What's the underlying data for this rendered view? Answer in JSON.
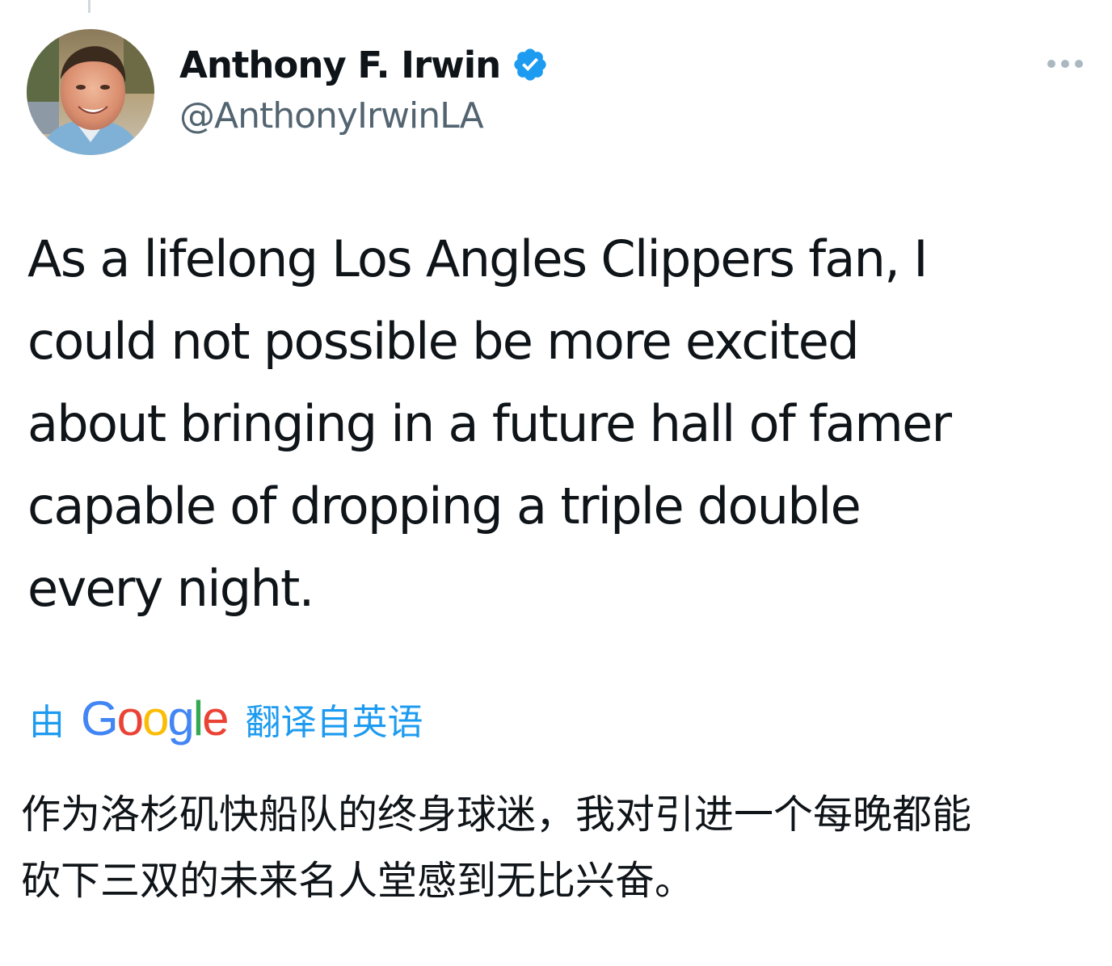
{
  "tweet": {
    "author": {
      "display_name": "Anthony F. Irwin",
      "handle": "@AnthonyIrwinLA",
      "verified": true,
      "verified_icon": "verified-badge-icon",
      "avatar_icon": "profile-photo"
    },
    "more_icon": "more-horizontal-icon",
    "text_lines": [
      "As a lifelong Los Angles Clippers fan, I",
      "could not possible be more excited",
      "about bringing in a future hall of famer",
      "capable of dropping a triple double",
      "every night."
    ],
    "translation": {
      "prefix": "由",
      "provider": "Google",
      "suffix": "翻译自英语",
      "lines": [
        "作为洛杉矶快船队的终身球迷，我对引进一个每晚都能",
        "砍下三双的未来名人堂感到无比兴奋。"
      ]
    }
  },
  "colors": {
    "text_primary": "#0f1419",
    "text_secondary": "#536471",
    "link_blue": "#1d9bf0",
    "verified_blue": "#1d9bf0",
    "google_blue": "#4285f4",
    "google_red": "#ea4335",
    "google_yellow": "#fbbc05",
    "google_green": "#34a853"
  }
}
